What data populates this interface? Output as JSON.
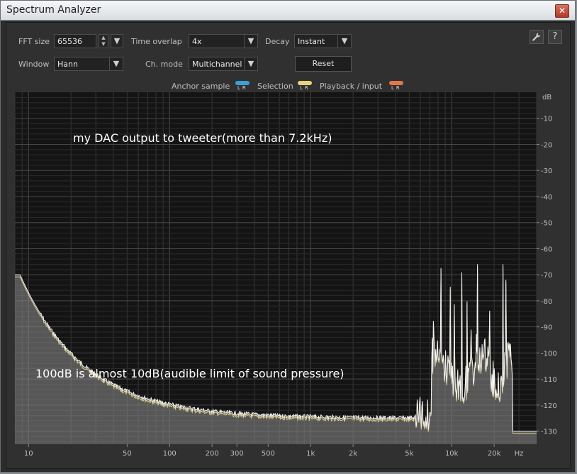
{
  "window": {
    "title": "Spectrum Analyzer",
    "close_glyph": "✕"
  },
  "toolbar": {
    "fft_size_label": "FFT size",
    "fft_size_value": "65536",
    "time_overlap_label": "Time overlap",
    "time_overlap_value": "4x",
    "decay_label": "Decay",
    "decay_value": "Instant",
    "window_label": "Window",
    "window_value": "Hann",
    "ch_mode_label": "Ch. mode",
    "ch_mode_value": "Multichannel",
    "reset_label": "Reset",
    "settings_icon": "wrench-icon",
    "help_icon": "help-icon",
    "help_glyph": "?"
  },
  "legend": {
    "anchor_label": "Anchor sample",
    "selection_label": "Selection",
    "playback_label": "Playback / input",
    "lr_text": "LR",
    "colors": {
      "anchor": "#3aa0d8",
      "selection": "#e8d27a",
      "playback": "#e0784a"
    }
  },
  "spectrum": {
    "annotation_top": "my DAC output to tweeter(more than 7.2kHz)",
    "annotation_bottom": "100dB is almost 10dB(audible limit of sound pressure)",
    "db_unit": "dB",
    "db_ticks": [
      "10",
      "20",
      "30",
      "40",
      "50",
      "60",
      "70",
      "80",
      "90",
      "100",
      "110",
      "120",
      "130"
    ],
    "hz_unit": "Hz",
    "freq_ticks": [
      "10",
      "50",
      "100",
      "200",
      "300",
      "500",
      "1k",
      "2k",
      "5k",
      "10k",
      "20k"
    ],
    "colors": {
      "background": "#141414",
      "grid": "#353535",
      "curve": "#f2f2f2",
      "fill": "#8e8e8e",
      "low_curve": "#d8c98e"
    }
  }
}
